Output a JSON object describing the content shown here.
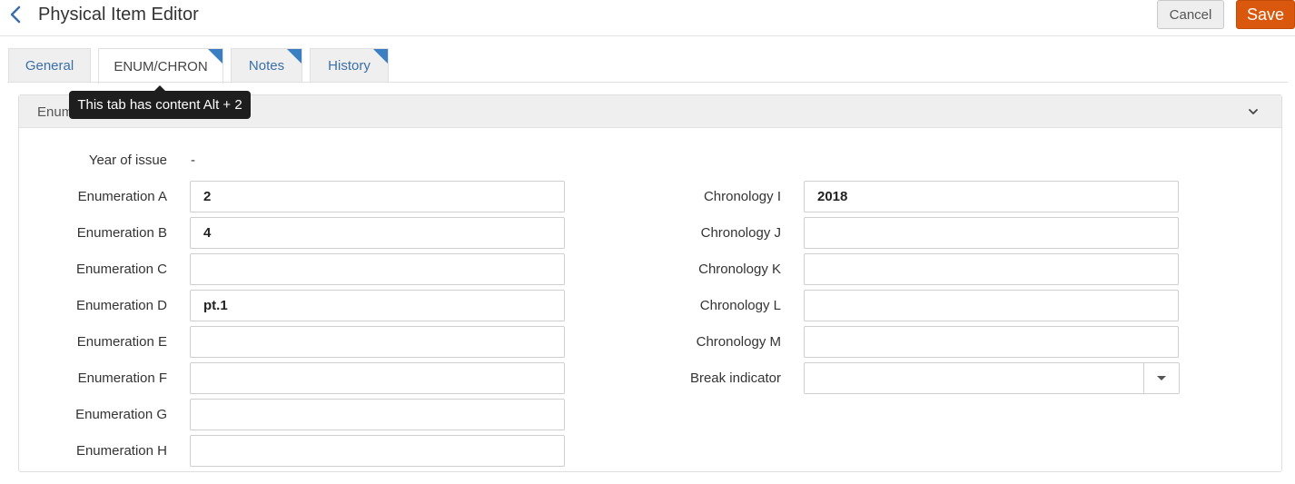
{
  "header": {
    "back_icon": "chevron-left-icon",
    "title": "Physical Item Editor",
    "cancel_label": "Cancel",
    "save_label": "Save",
    "save_color": "#d9580d"
  },
  "tabs": [
    {
      "label": "General",
      "active": false,
      "has_content": false
    },
    {
      "label": "ENUM/CHRON",
      "active": true,
      "has_content": true
    },
    {
      "label": "Notes",
      "active": false,
      "has_content": true
    },
    {
      "label": "History",
      "active": false,
      "has_content": true
    }
  ],
  "tooltip": "This tab has content Alt + 2",
  "panel": {
    "title": "Enumeration",
    "chevron_icon": "chevron-down-icon"
  },
  "fields": {
    "year_of_issue": {
      "label": "Year of issue",
      "value": "-"
    },
    "enum_a": {
      "label": "Enumeration A",
      "value": "2"
    },
    "enum_b": {
      "label": "Enumeration B",
      "value": "4"
    },
    "enum_c": {
      "label": "Enumeration C",
      "value": ""
    },
    "enum_d": {
      "label": "Enumeration D",
      "value": "pt.1"
    },
    "enum_e": {
      "label": "Enumeration E",
      "value": ""
    },
    "enum_f": {
      "label": "Enumeration F",
      "value": ""
    },
    "enum_g": {
      "label": "Enumeration G",
      "value": ""
    },
    "enum_h": {
      "label": "Enumeration H",
      "value": ""
    },
    "chron_i": {
      "label": "Chronology I",
      "value": "2018"
    },
    "chron_j": {
      "label": "Chronology J",
      "value": ""
    },
    "chron_k": {
      "label": "Chronology K",
      "value": ""
    },
    "chron_l": {
      "label": "Chronology L",
      "value": ""
    },
    "chron_m": {
      "label": "Chronology M",
      "value": ""
    },
    "break_indicator": {
      "label": "Break indicator",
      "value": ""
    }
  },
  "colors": {
    "link": "#3a6fa8",
    "tab_corner": "#3a7fc1",
    "tooltip_bg": "#1e1e1e"
  }
}
